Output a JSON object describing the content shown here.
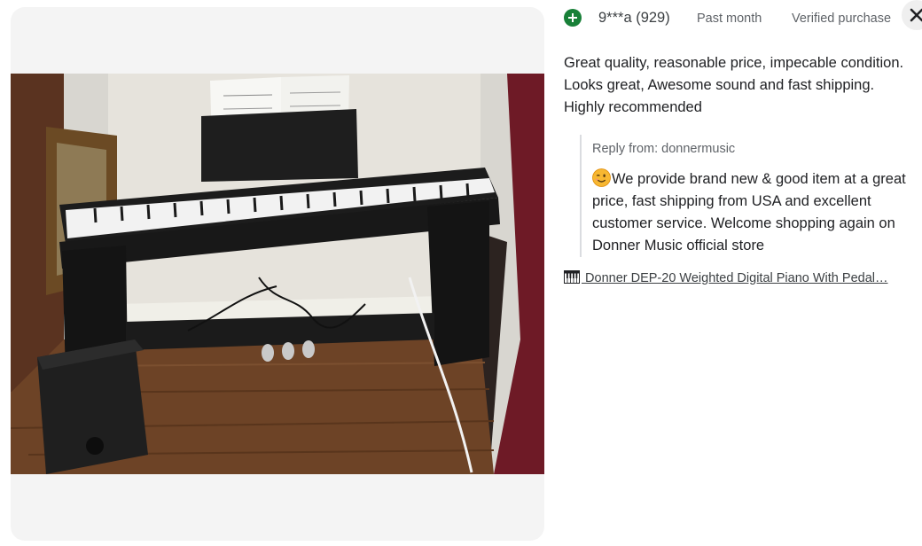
{
  "review": {
    "reviewer": "9***a (929)",
    "time": "Past month",
    "verified": "Verified purchase",
    "text": "Great quality, reasonable price, impecable condition. Looks great, Awesome sound and fast shipping. Highly recommended",
    "reply_from": "Reply from: donnermusic",
    "reply_text": "We provide brand new & good item at a great price, fast shipping from USA and excellent customer service. Welcome shopping again on Donner Music official store",
    "reply_emoji": "winking-face-emoji"
  },
  "product": {
    "link_text": " Donner DEP-20 Weighted Digital Piano With Pedal…",
    "icon": "piano-icon"
  },
  "media": {
    "photo_icon": "review-photo-digital-piano"
  },
  "controls": {
    "close_icon": "close-icon"
  },
  "colors": {
    "avatar": "#188038",
    "panel_bg": "#f4f4f4",
    "secondary_text": "#5f6368",
    "primary_text": "#202124"
  }
}
